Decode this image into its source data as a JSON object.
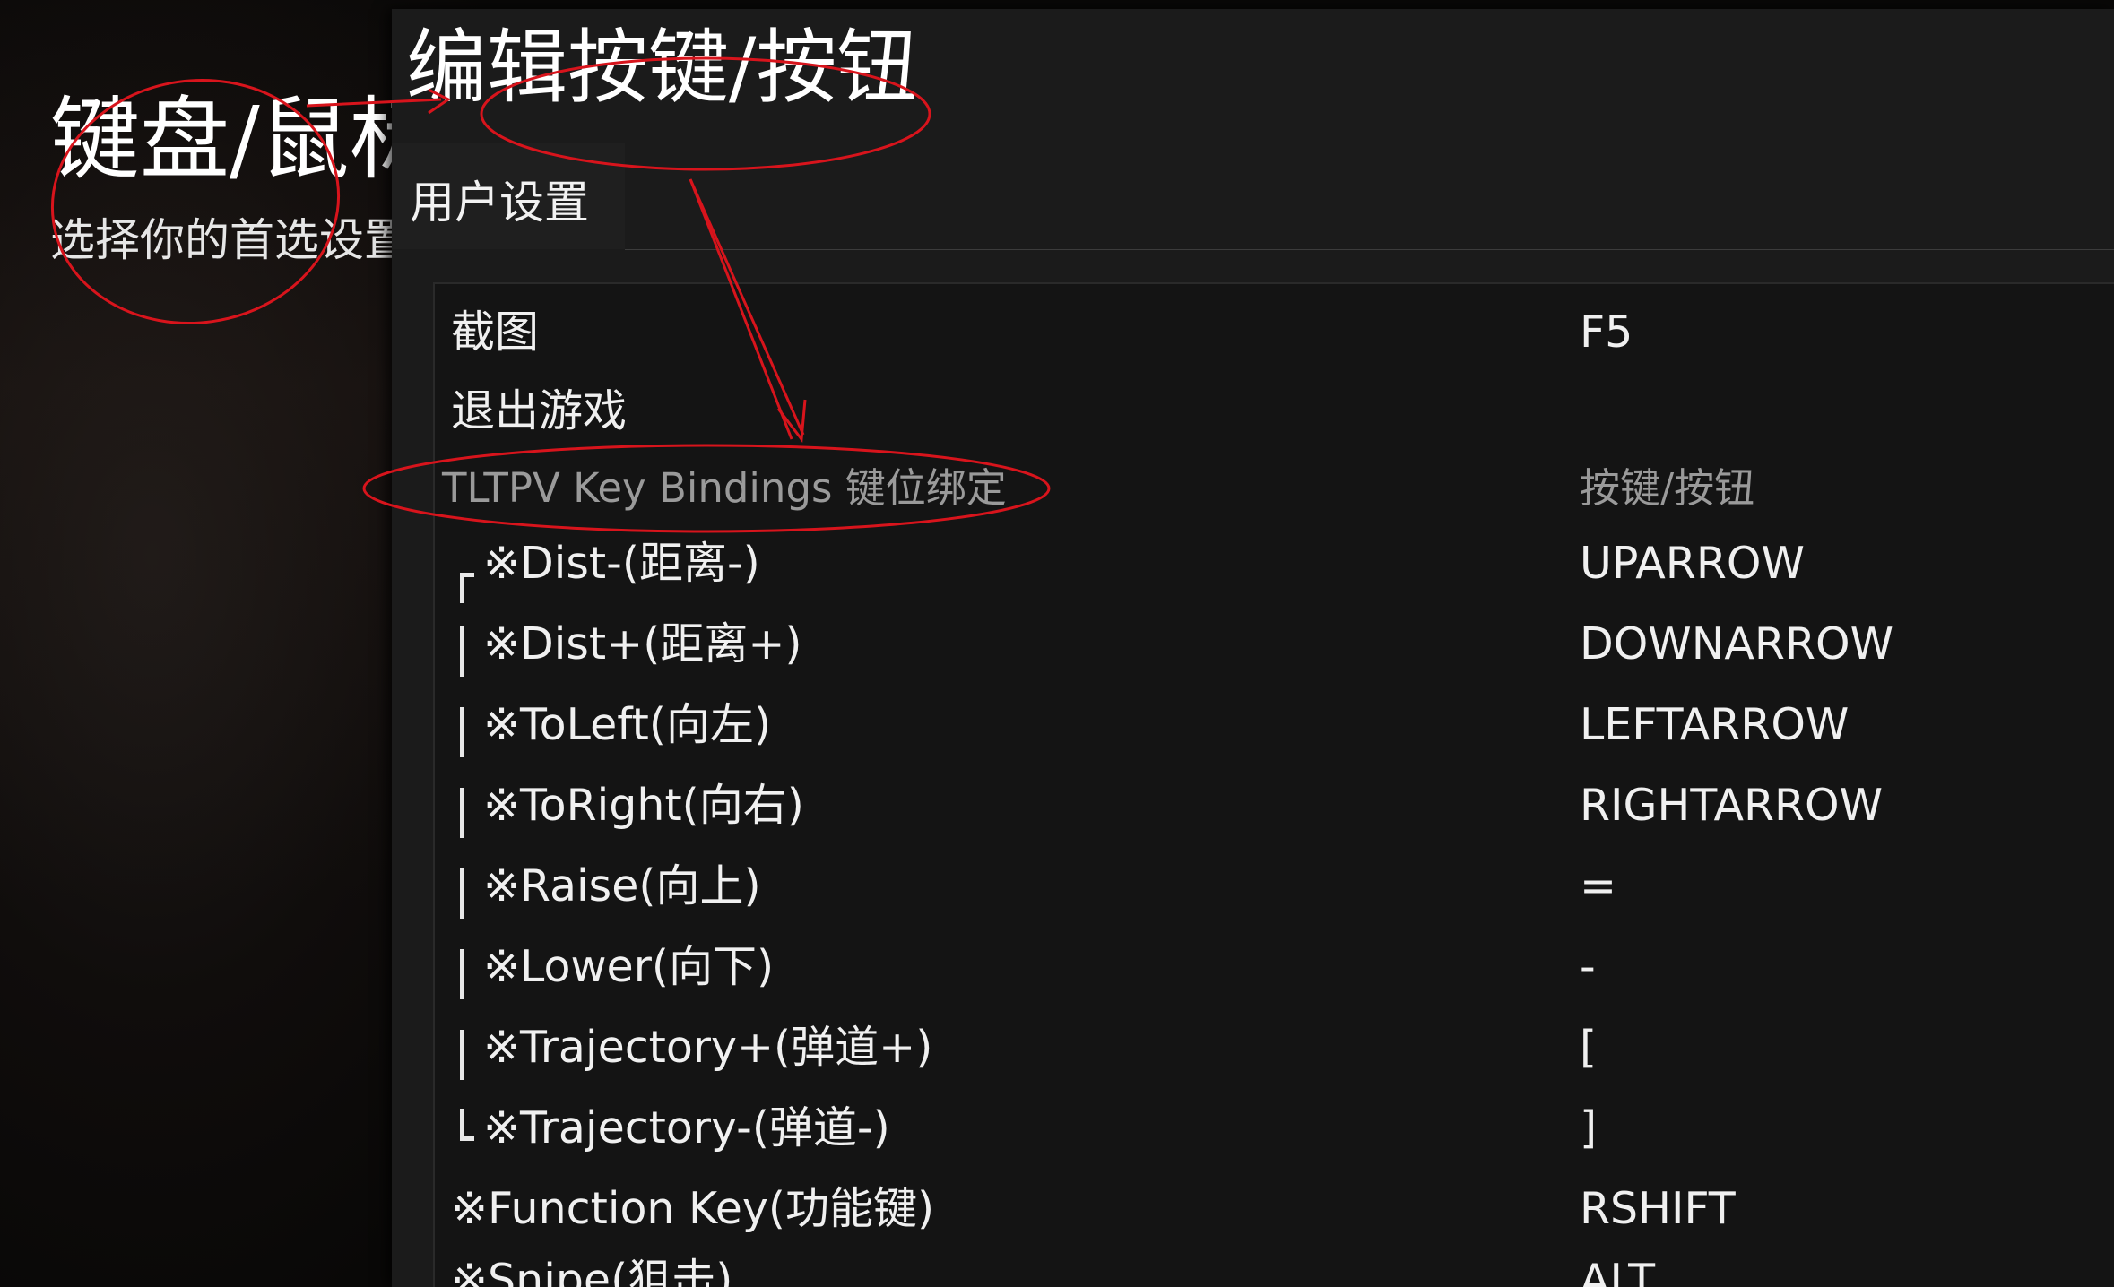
{
  "background": {
    "title": "键盘/鼠标",
    "subtitle": "选择你的首选设置"
  },
  "dialog": {
    "title": "编辑按键/按钮",
    "tab_label": "用户设置"
  },
  "general_bindings": [
    {
      "label": "截图",
      "key": "F5"
    },
    {
      "label": "退出游戏",
      "key": ""
    }
  ],
  "section_header": {
    "label": "TLTPV Key Bindings 键位绑定",
    "column": "按键/按钮"
  },
  "tltpv_bindings": [
    {
      "label": "※Dist-(距离-)",
      "key": "UPARROW",
      "tree": "top"
    },
    {
      "label": "※Dist+(距离+)",
      "key": "DOWNARROW",
      "tree": "mid"
    },
    {
      "label": "※ToLeft(向左)",
      "key": "LEFTARROW",
      "tree": "mid"
    },
    {
      "label": "※ToRight(向右)",
      "key": "RIGHTARROW",
      "tree": "mid"
    },
    {
      "label": "※Raise(向上)",
      "key": "=",
      "tree": "mid"
    },
    {
      "label": "※Lower(向下)",
      "key": "-",
      "tree": "mid"
    },
    {
      "label": "※Trajectory+(弹道+)",
      "key": "[",
      "tree": "mid"
    },
    {
      "label": "※Trajectory-(弹道-)",
      "key": "]",
      "tree": "bottom"
    },
    {
      "label": "※Function Key(功能键)",
      "key": "RSHIFT",
      "tree": "none"
    },
    {
      "label": "※Snipe(狙击)",
      "key": "ALT",
      "tree": "none"
    }
  ],
  "colors": {
    "annotation": "#d8141c",
    "dialog_bg": "#1b1b1b",
    "list_bg": "#141414",
    "section_text": "#9a9a9a"
  }
}
